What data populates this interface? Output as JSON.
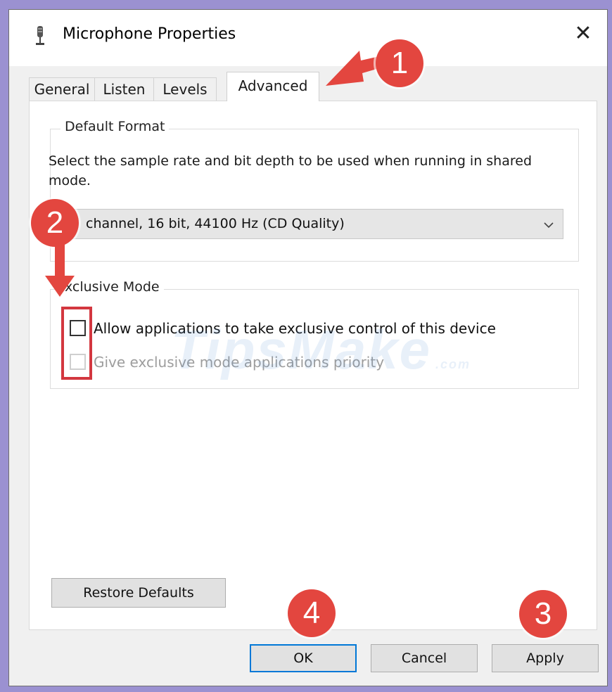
{
  "window": {
    "title": "Microphone Properties",
    "close_glyph": "✕"
  },
  "tabs": [
    {
      "label": "General"
    },
    {
      "label": "Listen"
    },
    {
      "label": "Levels"
    },
    {
      "label": "Advanced",
      "active": true
    }
  ],
  "default_format": {
    "legend": "Default Format",
    "description": "Select the sample rate and bit depth to be used when running in shared mode.",
    "selected_value": "channel, 16 bit, 44100 Hz (CD Quality)"
  },
  "exclusive_mode": {
    "legend": "xclusive Mode",
    "options": [
      {
        "label": "Allow applications to take exclusive control of this device",
        "checked": false,
        "enabled": true
      },
      {
        "label": "Give exclusive mode applications priority",
        "checked": false,
        "enabled": false
      }
    ]
  },
  "buttons": {
    "restore_defaults": "Restore Defaults",
    "ok": "OK",
    "cancel": "Cancel",
    "apply": "Apply"
  },
  "annotations": {
    "badge_1": "1",
    "badge_2": "2",
    "badge_3": "3",
    "badge_4": "4",
    "color": "#e3463f"
  },
  "watermark": {
    "brand": "TipsMake",
    "suffix": ".com"
  },
  "icons": {
    "title_icon": "microphone-icon",
    "dropdown": "chevron-down-icon",
    "close": "close-icon"
  }
}
